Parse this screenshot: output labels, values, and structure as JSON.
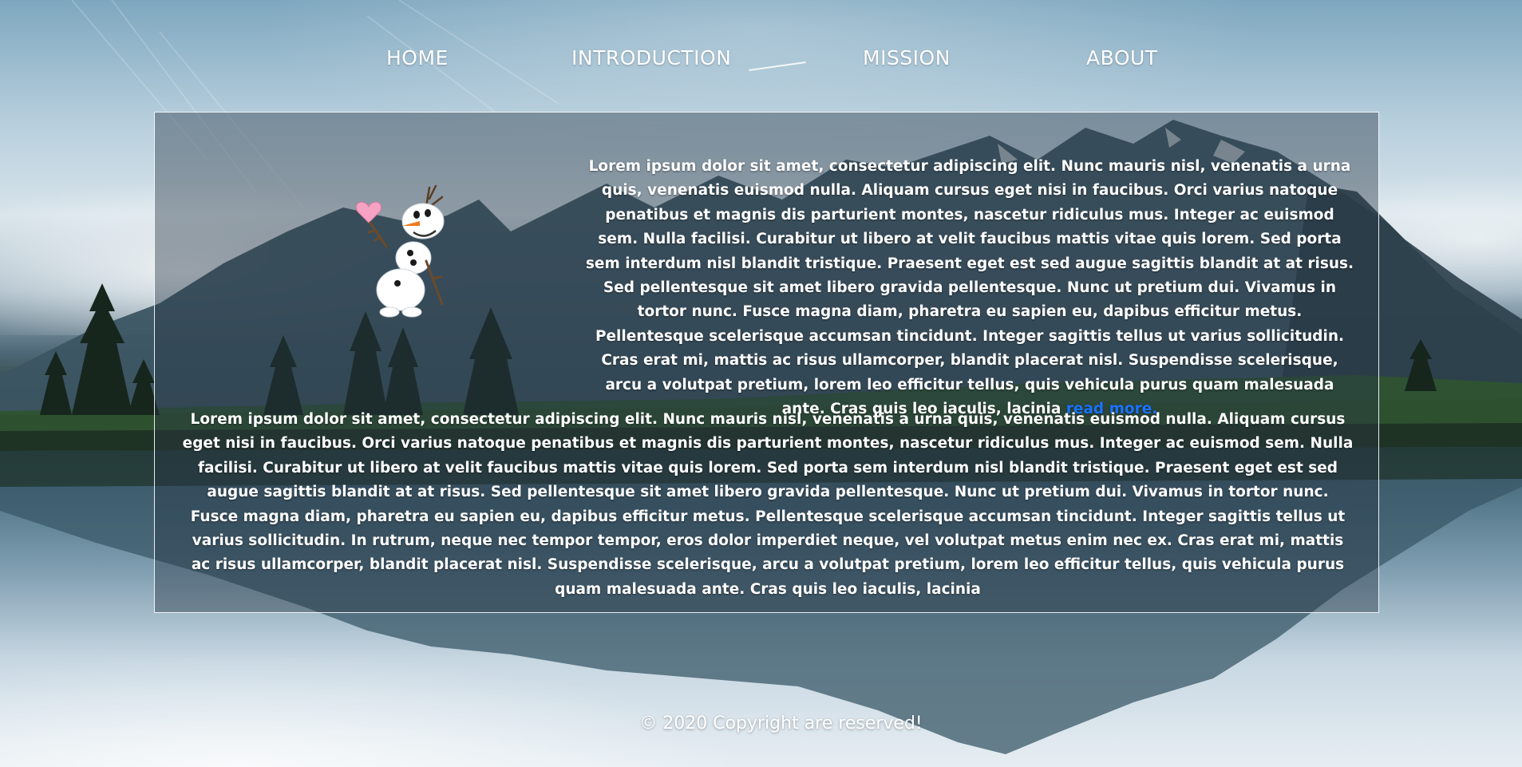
{
  "nav": {
    "items": [
      {
        "label": "HOME"
      },
      {
        "label": "INTRODUCTION"
      },
      {
        "label": "MISSION"
      },
      {
        "label": "ABOUT"
      }
    ]
  },
  "content": {
    "paragraph_1": "Lorem ipsum dolor sit amet, consectetur adipiscing elit. Nunc mauris nisl, venenatis a urna quis, venenatis euismod nulla. Aliquam cursus eget nisi in faucibus. Orci varius natoque penatibus et magnis dis parturient montes, nascetur ridiculus mus. Integer ac euismod sem. Nulla facilisi. Curabitur ut libero at velit faucibus mattis vitae quis lorem. Sed porta sem interdum nisl blandit tristique. Praesent eget est sed augue sagittis blandit at at risus. Sed pellentesque sit amet libero gravida pellentesque. Nunc ut pretium dui. Vivamus in tortor nunc. Fusce magna diam, pharetra eu sapien eu, dapibus efficitur metus. Pellentesque scelerisque accumsan tincidunt. Integer sagittis tellus ut varius sollicitudin. Cras erat mi, mattis ac risus ullamcorper, blandit placerat nisl. Suspendisse scelerisque, arcu a volutpat pretium, lorem leo efficitur tellus, quis vehicula purus quam malesuada ante. Cras quis leo iaculis, lacinia",
    "read_more_label": "read more.",
    "paragraph_2": "Lorem ipsum dolor sit amet, consectetur adipiscing elit. Nunc mauris nisl, venenatis a urna quis, venenatis euismod nulla. Aliquam cursus eget nisi in faucibus. Orci varius natoque penatibus et magnis dis parturient montes, nascetur ridiculus mus. Integer ac euismod sem. Nulla facilisi. Curabitur ut libero at velit faucibus mattis vitae quis lorem. Sed porta sem interdum nisl blandit tristique. Praesent eget est sed augue sagittis blandit at at risus. Sed pellentesque sit amet libero gravida pellentesque. Nunc ut pretium dui. Vivamus in tortor nunc. Fusce magna diam, pharetra eu sapien eu, dapibus efficitur metus. Pellentesque scelerisque accumsan tincidunt. Integer sagittis tellus ut varius sollicitudin. In rutrum, neque nec tempor tempor, eros dolor imperdiet neque, vel volutpat metus enim nec ex. Cras erat mi, mattis ac risus ullamcorper, blandit placerat nisl. Suspendisse scelerisque, arcu a volutpat pretium, lorem leo efficitur tellus, quis vehicula purus quam malesuada ante. Cras quis leo iaculis, lacinia"
  },
  "footer": {
    "copyright": "© 2020 Copyright are reserved!"
  },
  "icons": {
    "illustration": "snowman-holding-heart-icon",
    "background": "mountain-lake-background"
  },
  "colors": {
    "link": "#1a73ff",
    "text": "#ffffff",
    "panel_border": "#ffffff"
  }
}
